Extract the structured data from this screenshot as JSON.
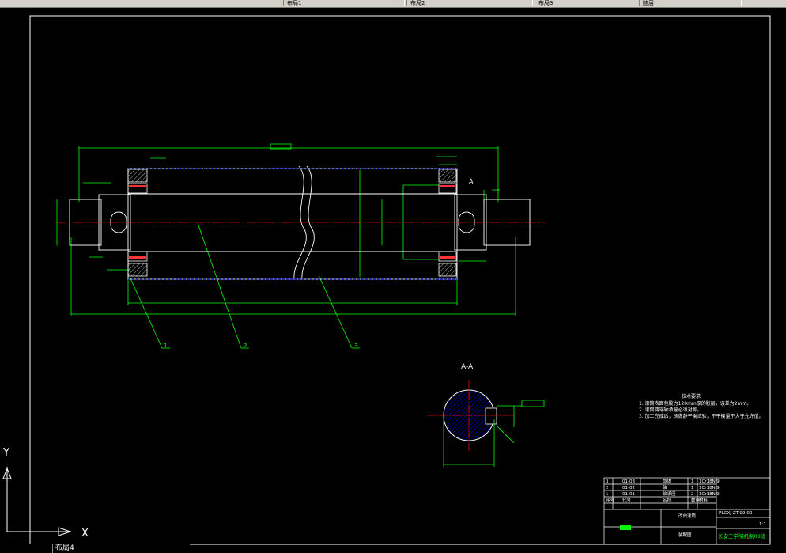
{
  "toolbar": {
    "tabs": [
      {
        "label": "布局1"
      },
      {
        "label": "布局2"
      },
      {
        "label": "布局3"
      },
      {
        "label": "布局4"
      },
      {
        "label": "随层"
      }
    ]
  },
  "drawing": {
    "section_label": "A-A",
    "section_marker": "A",
    "callouts": [
      "1",
      "2",
      "3"
    ],
    "tech_requirements": {
      "title": "技术要求",
      "items": [
        "1. 滚筒表面包胶为120mm厚的胶层，误差为2mm。",
        "2. 滚筒两端轴承座必须对称。",
        "3. 加工完成后，须做静平衡试验，不平衡量不大于允许值。"
      ]
    },
    "title_block": {
      "parts": [
        {
          "no": "3",
          "code": "01-03",
          "name": "筒体",
          "qty": "1",
          "material": "1Cr18Ni9"
        },
        {
          "no": "2",
          "code": "01-02",
          "name": "轴",
          "qty": "1",
          "material": "1Cr18Ni9"
        },
        {
          "no": "1",
          "code": "01-01",
          "name": "轴承座",
          "qty": "2",
          "material": "1Cr18Ni9"
        }
      ],
      "header": [
        "序号",
        "代号",
        "名称",
        "数量",
        "材料"
      ],
      "drawing_name": "改向滚筒",
      "drawing_no": "PLGXJ-ZT-02-00",
      "assembly_label": "装配图",
      "scale": "1:1",
      "school": "长安工学院机制08班"
    }
  },
  "ucs": {
    "x_label": "X",
    "y_label": "Y"
  },
  "colors": {
    "border": "#ffffff",
    "dimension": "#00ff00",
    "center": "#ff0000",
    "hatch": "#0000ff",
    "text": "#ffffff",
    "highlight": "#ffff00"
  }
}
